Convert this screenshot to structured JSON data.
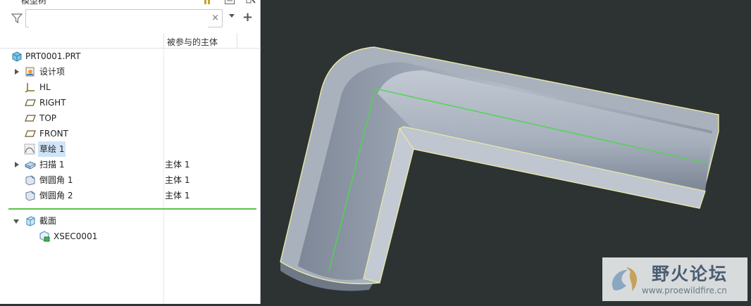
{
  "panel": {
    "title": "模型树",
    "search": {
      "value": "",
      "placeholder": ""
    },
    "clear_glyph": "×",
    "add_glyph": "+",
    "column_header": "被参与的主体"
  },
  "tree": {
    "items": [
      {
        "label": "PRT0001.PRT",
        "body": "",
        "icon": "part-icon",
        "expandable": false
      },
      {
        "label": "设计项",
        "body": "",
        "icon": "design-items-icon",
        "expandable": true
      },
      {
        "label": "HL",
        "body": "",
        "icon": "coordinate-system-icon",
        "expandable": false
      },
      {
        "label": "RIGHT",
        "body": "",
        "icon": "datum-plane-icon",
        "expandable": false
      },
      {
        "label": "TOP",
        "body": "",
        "icon": "datum-plane-icon",
        "expandable": false
      },
      {
        "label": "FRONT",
        "body": "",
        "icon": "datum-plane-icon",
        "expandable": false
      },
      {
        "label": "草绘 1",
        "body": "",
        "icon": "sketch-icon",
        "expandable": false,
        "selected": true
      },
      {
        "label": "扫描 1",
        "body": "主体 1",
        "icon": "sweep-icon",
        "expandable": true
      },
      {
        "label": "倒圆角 1",
        "body": "主体 1",
        "icon": "round-icon",
        "expandable": false
      },
      {
        "label": "倒圆角 2",
        "body": "主体 1",
        "icon": "round-icon",
        "expandable": false
      }
    ],
    "sections": {
      "label": "截面",
      "icon": "section-icon",
      "children": [
        {
          "label": "XSEC0001",
          "icon": "xsection-icon"
        }
      ]
    }
  },
  "watermark": {
    "title": "野火论坛",
    "url": "www.proewildfire.cn"
  },
  "colors": {
    "viewport_bg": "#2d3233",
    "model_face": "#a9b1bd",
    "model_edge": "#e9e8a6",
    "sketch_line": "#4fd64f",
    "insert_line": "#5cc14a",
    "selection": "#cfe4f7"
  }
}
